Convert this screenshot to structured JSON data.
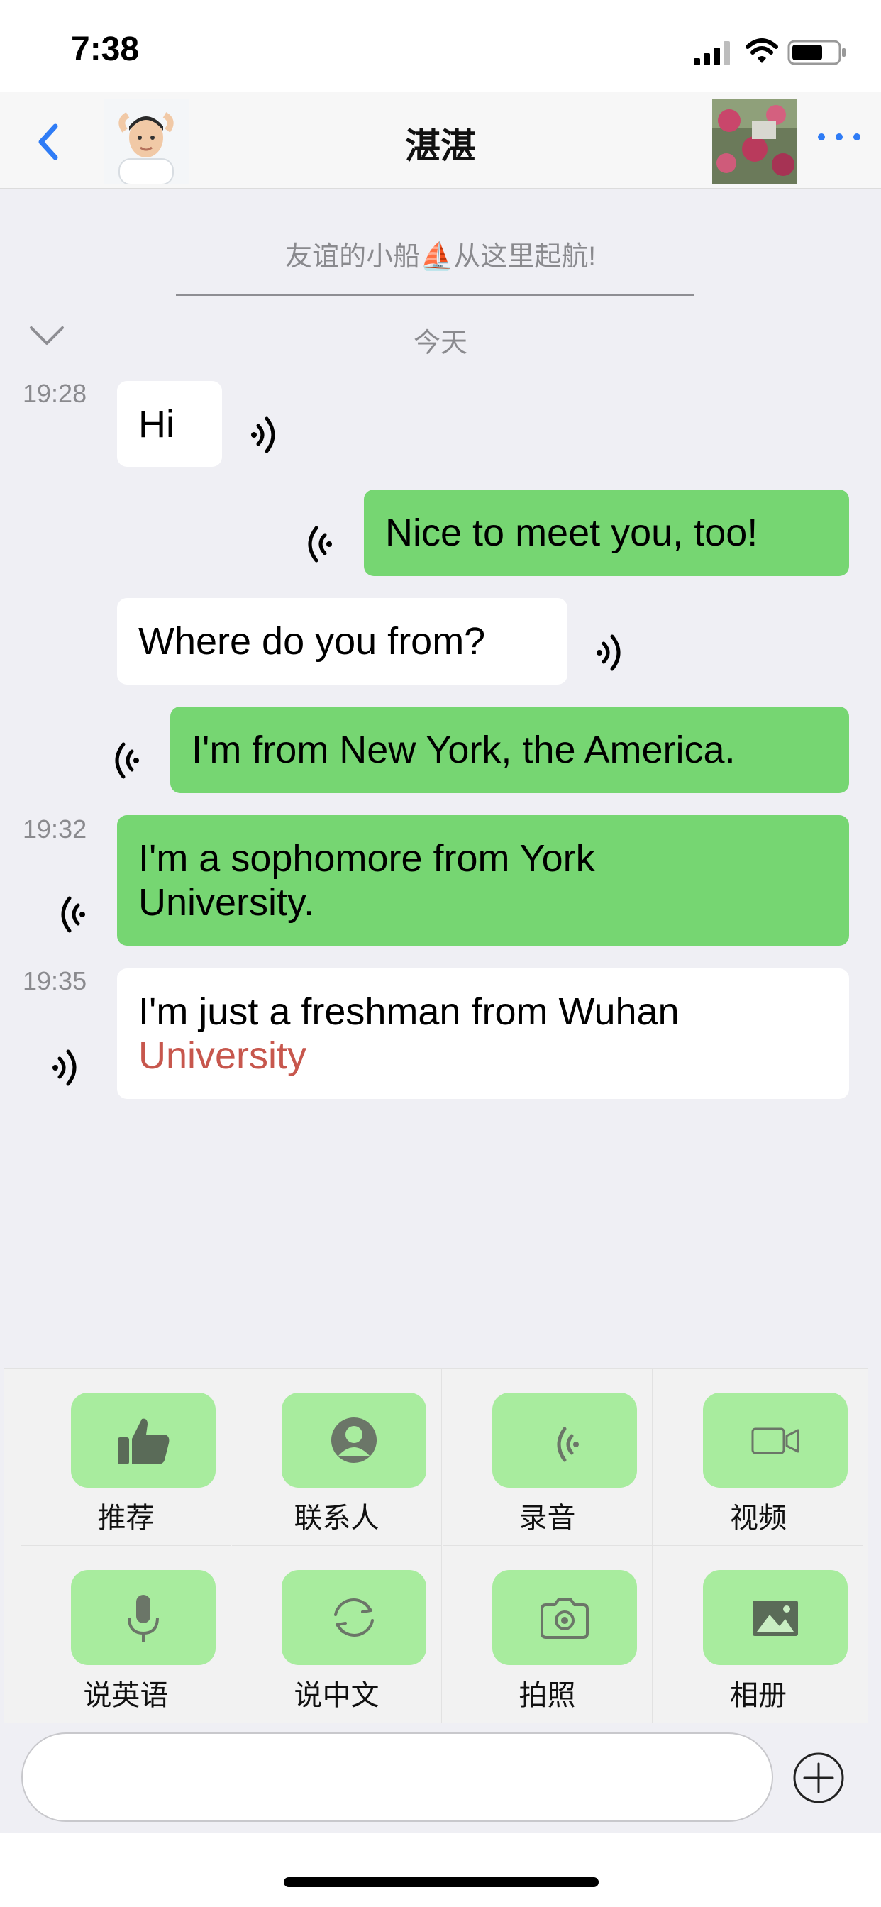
{
  "status": {
    "time": "7:38"
  },
  "header": {
    "title": "湛湛",
    "left_avatar": "avatar-boy",
    "right_avatar": "avatar-flowers"
  },
  "chat": {
    "intro": "友谊的小船⛵从这里起航!",
    "day": "今天",
    "messages": [
      {
        "time": "19:28",
        "text": "Hi",
        "side": "left"
      },
      {
        "time": "",
        "text": "Nice to meet you, too!",
        "side": "right"
      },
      {
        "time": "",
        "text": "Where do you from?",
        "side": "left"
      },
      {
        "time": "",
        "text": "I'm from New York, the America.",
        "side": "right"
      },
      {
        "time": "19:32",
        "line1": "I'm a sophomore from York",
        "line2": "University.",
        "side": "right"
      },
      {
        "time": "19:35",
        "line1": "I'm just a freshman from Wuhan",
        "line2": "University",
        "side": "left",
        "highlight_color": "#c7574d"
      }
    ]
  },
  "panel": {
    "row1": [
      {
        "label": "推荐",
        "icon": "thumbs-up-icon"
      },
      {
        "label": "联系人",
        "icon": "contact-icon"
      },
      {
        "label": "录音",
        "icon": "audio-wave-icon"
      },
      {
        "label": "视频",
        "icon": "video-camera-icon"
      }
    ],
    "row2": [
      {
        "label": "说英语",
        "icon": "microphone-icon"
      },
      {
        "label": "说中文",
        "icon": "refresh-icon"
      },
      {
        "label": "拍照",
        "icon": "camera-icon"
      },
      {
        "label": "相册",
        "icon": "photo-album-icon"
      }
    ]
  },
  "input": {
    "placeholder": ""
  },
  "colors": {
    "outgoing_bubble": "#76d672",
    "incoming_bubble": "#ffffff",
    "action_button": "#a8ec9e",
    "accent_blue": "#2f7cf6"
  }
}
